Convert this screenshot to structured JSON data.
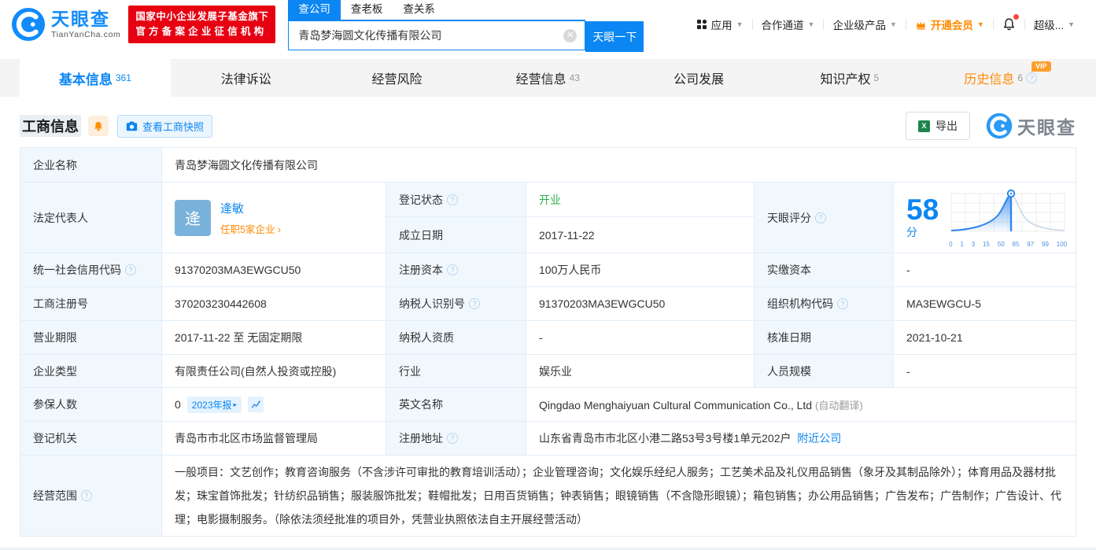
{
  "header": {
    "brand": "天眼查",
    "brand_domain": "TianYanCha.com",
    "badge_line1": "国家中小企业发展子基金旗下",
    "badge_line2": "官方备案企业征信机构",
    "search_tabs": [
      {
        "label": "查公司"
      },
      {
        "label": "查老板"
      },
      {
        "label": "查关系"
      }
    ],
    "search_value": "青岛梦海圆文化传播有限公司",
    "search_button": "天眼一下",
    "menu": [
      {
        "label": "应用"
      },
      {
        "label": "合作通道"
      },
      {
        "label": "企业级产品"
      },
      {
        "label": "开通会员"
      },
      {
        "label": "超级..."
      }
    ]
  },
  "nav_tabs": [
    {
      "label": "基本信息",
      "count": "361"
    },
    {
      "label": "法律诉讼",
      "count": ""
    },
    {
      "label": "经营风险",
      "count": ""
    },
    {
      "label": "经营信息",
      "count": "43"
    },
    {
      "label": "公司发展",
      "count": ""
    },
    {
      "label": "知识产权",
      "count": "5"
    },
    {
      "label": "历史信息",
      "count": "6",
      "badge": "VIP"
    }
  ],
  "section": {
    "title": "工商信息",
    "snapshot_button": "查看工商快照",
    "export_button": "导出",
    "watermark": "天眼查"
  },
  "company": {
    "name": {
      "label": "企业名称",
      "value": "青岛梦海圆文化传播有限公司"
    },
    "legal_rep": {
      "label": "法定代表人",
      "avatar_char": "逄",
      "name": "逄敏",
      "link": "任职5家企业"
    },
    "reg_status": {
      "label": "登记状态",
      "value": "开业"
    },
    "est_date": {
      "label": "成立日期",
      "value": "2017-11-22"
    },
    "score": {
      "label": "天眼评分",
      "value": "58",
      "unit": "分",
      "axis": [
        "0",
        "1",
        "3",
        "15",
        "50",
        "85",
        "97",
        "99",
        "100"
      ]
    },
    "credit_code": {
      "label": "统一社会信用代码",
      "value": "91370203MA3EWGCU50"
    },
    "reg_capital": {
      "label": "注册资本",
      "value": "100万人民币"
    },
    "paid_capital": {
      "label": "实缴资本",
      "value": "-"
    },
    "reg_number": {
      "label": "工商注册号",
      "value": "370203230442608"
    },
    "taxpayer_id": {
      "label": "纳税人识别号",
      "value": "91370203MA3EWGCU50"
    },
    "org_code": {
      "label": "组织机构代码",
      "value": "MA3EWGCU-5"
    },
    "term": {
      "label": "营业期限",
      "value": "2017-11-22 至 无固定期限"
    },
    "taxpayer_quality": {
      "label": "纳税人资质",
      "value": "-"
    },
    "approval_date": {
      "label": "核准日期",
      "value": "2021-10-21"
    },
    "type": {
      "label": "企业类型",
      "value": "有限责任公司(自然人投资或控股)"
    },
    "industry": {
      "label": "行业",
      "value": "娱乐业"
    },
    "staff_size": {
      "label": "人员规模",
      "value": "-"
    },
    "insured": {
      "label": "参保人数",
      "value": "0",
      "tag": "2023年报"
    },
    "english_name": {
      "label": "英文名称",
      "value": "Qingdao Menghaiyuan Cultural Communication Co., Ltd",
      "note": "(自动翻译)"
    },
    "authority": {
      "label": "登记机关",
      "value": "青岛市市北区市场监督管理局"
    },
    "address": {
      "label": "注册地址",
      "value": "山东省青岛市市北区小港二路53号3号楼1单元202户",
      "link": "附近公司"
    },
    "scope": {
      "label": "经营范围",
      "value": "一般项目：文艺创作；教育咨询服务（不含涉许可审批的教育培训活动）；企业管理咨询；文化娱乐经纪人服务；工艺美术品及礼仪用品销售（象牙及其制品除外）；体育用品及器材批发；珠宝首饰批发；针纺织品销售；服装服饰批发；鞋帽批发；日用百货销售；钟表销售；眼镜销售（不含隐形眼镜）；箱包销售；办公用品销售；广告发布；广告制作；广告设计、代理；电影摄制服务。（除依法须经批准的项目外，凭营业执照依法自主开展经营活动）"
    }
  },
  "colors": {
    "primary": "#0b86f3",
    "orange": "#ff8a00",
    "green": "#2bb24c",
    "badge_red": "#e60012"
  }
}
